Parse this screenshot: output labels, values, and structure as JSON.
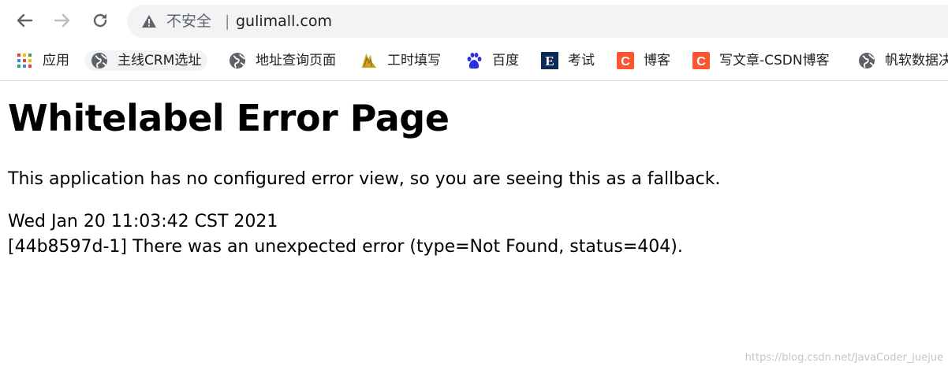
{
  "browser": {
    "security_label": "不安全",
    "separator": "|",
    "url": "gulimall.com",
    "back_icon": "arrow-left-icon",
    "forward_icon": "arrow-right-icon",
    "reload_icon": "reload-icon",
    "warning_icon": "warning-triangle-icon"
  },
  "bookmarks": [
    {
      "label": "应用",
      "icon": "apps-grid-icon"
    },
    {
      "label": "主线CRM选址",
      "icon": "globe-icon"
    },
    {
      "label": "地址查询页面",
      "icon": "globe-icon"
    },
    {
      "label": "工时填写",
      "icon": "gold-logo-icon"
    },
    {
      "label": "百度",
      "icon": "baidu-paw-icon"
    },
    {
      "label": "考试",
      "icon": "e-logo-icon"
    },
    {
      "label": "博客",
      "icon": "csdn-c-icon"
    },
    {
      "label": "写文章-CSDN博客",
      "icon": "csdn-c-icon"
    },
    {
      "label": "帆软数据决",
      "icon": "globe-icon"
    }
  ],
  "page": {
    "title": "Whitelabel Error Page",
    "description": "This application has no configured error view, so you are seeing this as a fallback.",
    "timestamp": "Wed Jan 20 11:03:42 CST 2021",
    "error": "[44b8597d-1] There was an unexpected error (type=Not Found, status=404)."
  },
  "watermark": "https://blog.csdn.net/JavaCoder_juejue",
  "colors": {
    "omnibox_bg": "#f1f3f4",
    "icon_gray": "#5f6368",
    "csdn_red": "#fc5531",
    "baidu_blue": "#2932e1"
  }
}
